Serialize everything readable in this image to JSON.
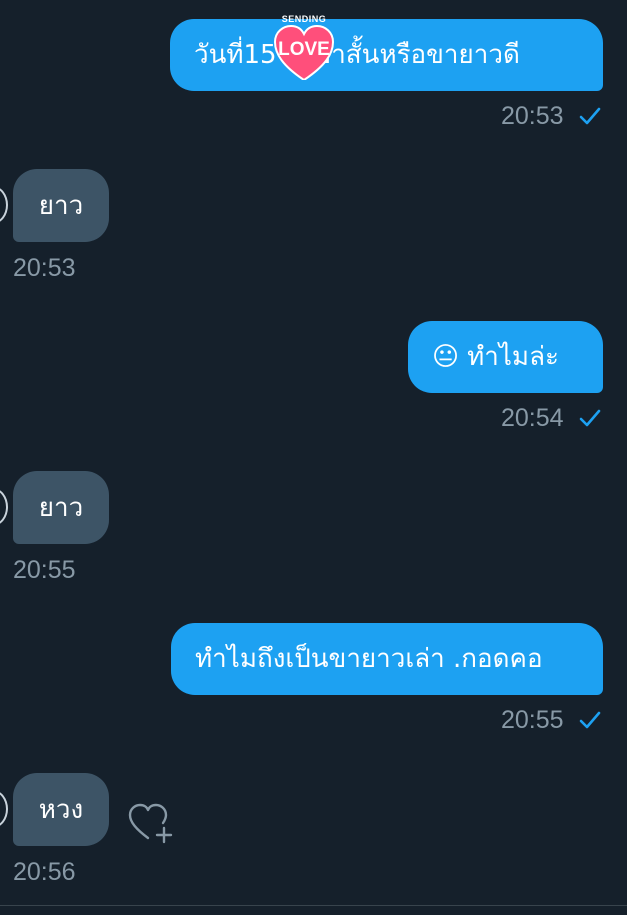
{
  "colors": {
    "background": "#15202b",
    "outgoing_bubble": "#1da1f2",
    "incoming_bubble": "#3d5466",
    "timestamp": "#8899a6",
    "read_check": "#1da1f2",
    "sticker_heart": "#ff4f7b"
  },
  "messages": [
    {
      "direction": "out",
      "text": "วันที่15 ใส่ขาสั้นหรือขายาวดี",
      "time": "20:53",
      "status_icon": "check-icon"
    },
    {
      "direction": "in",
      "text": "ยาว",
      "time": "20:53"
    },
    {
      "direction": "out",
      "emoji": "😐",
      "text": "ทำไมล่ะ",
      "time": "20:54",
      "status_icon": "check-icon"
    },
    {
      "direction": "in",
      "text": "ยาว",
      "time": "20:55"
    },
    {
      "direction": "out",
      "text": "ทำไมถึงเป็นขายาวเล่า .กอดคอ",
      "time": "20:55",
      "status_icon": "check-icon"
    },
    {
      "direction": "in",
      "text": "หวง",
      "time": "20:56",
      "action_icon": "heart-plus-icon"
    }
  ],
  "sticker": {
    "top_text": "SENDING",
    "main_text": "LOVE",
    "icon": "heart-icon"
  }
}
